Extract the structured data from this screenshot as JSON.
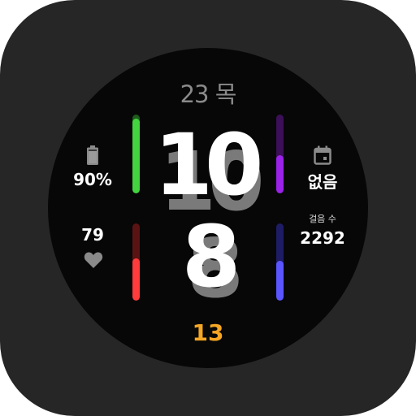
{
  "date": {
    "text": "23 목"
  },
  "time": {
    "hour": "10",
    "minute": "8",
    "second": "13"
  },
  "battery": {
    "value": "90%",
    "level": 0.9
  },
  "heart_rate": {
    "value": "79"
  },
  "calendar": {
    "value": "없음"
  },
  "steps": {
    "label": "걸음 수",
    "value": "2292"
  },
  "gauges": {
    "battery_bar": {
      "level": 0.95,
      "color": "#43d43f",
      "track": "#1f5a1d"
    },
    "calendar_bar": {
      "level": 0.48,
      "color": "#9b22e8",
      "track": "#3c0f58"
    },
    "heart_bar": {
      "level": 0.55,
      "color": "#ff3b3b",
      "track": "#5a1313"
    },
    "steps_bar": {
      "level": 0.52,
      "color": "#5a55ff",
      "track": "#1f1c66"
    }
  },
  "colors": {
    "accent_seconds": "#f5a623",
    "date": "#8a8a8a"
  },
  "icons": {
    "battery": "battery-icon",
    "heart": "heart-icon",
    "calendar": "calendar-icon"
  }
}
